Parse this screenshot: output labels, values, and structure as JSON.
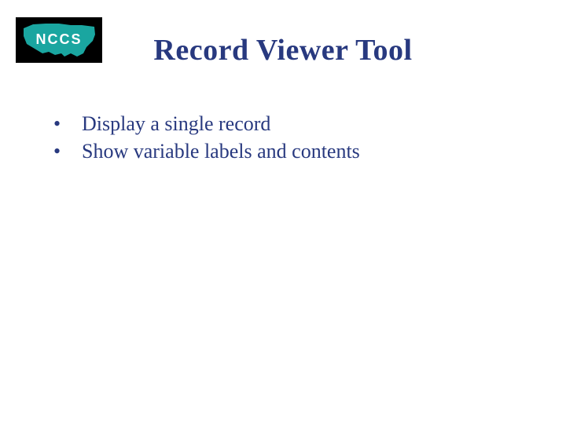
{
  "logo": {
    "label": "NCCS",
    "alt": "NCCS logo (teal US map silhouette on black)"
  },
  "title": "Record Viewer Tool",
  "bullets": [
    {
      "text": "Display a single record"
    },
    {
      "text": "Show variable labels and contents"
    }
  ]
}
